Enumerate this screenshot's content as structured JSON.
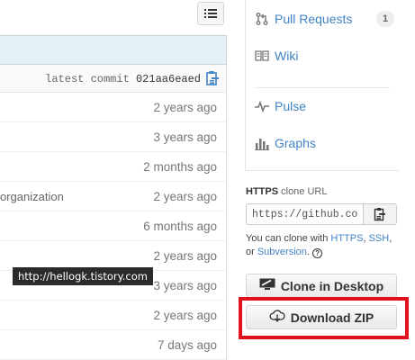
{
  "file_list": {
    "latest_commit_label": "latest commit",
    "latest_commit_sha": "021aa6eaed",
    "rows": [
      {
        "message": "",
        "age": "2 years ago"
      },
      {
        "message": "",
        "age": "3 years ago"
      },
      {
        "message": "",
        "age": "2 months ago"
      },
      {
        "message": "organization",
        "age": "2 years ago"
      },
      {
        "message": "",
        "age": "6 months ago"
      },
      {
        "message": "",
        "age": "2 years ago"
      },
      {
        "message": "",
        "age": "3 years ago"
      },
      {
        "message": "",
        "age": "2 years ago"
      },
      {
        "message": "",
        "age": "7 days ago"
      }
    ]
  },
  "watermark": "http://hellogk.tistory.com",
  "sidebar": {
    "nav": [
      {
        "label": "Pull Requests",
        "icon": "pull-request-icon",
        "count": "1"
      },
      {
        "label": "Wiki",
        "icon": "book-icon"
      },
      {
        "label": "Pulse",
        "icon": "pulse-icon"
      },
      {
        "label": "Graphs",
        "icon": "graph-icon"
      }
    ]
  },
  "clone": {
    "protocol": "HTTPS",
    "title_suffix": "clone URL",
    "url": "https://github.com/",
    "help_prefix": "You can clone with",
    "https_link": "HTTPS",
    "comma": ",",
    "ssh_link": "SSH",
    "help_or": ",\nor",
    "subversion_link": "Subversion",
    "help_end": "."
  },
  "buttons": {
    "desktop": "Clone in Desktop",
    "zip": "Download ZIP"
  },
  "colors": {
    "link": "#4183c4",
    "highlight": "#e0121c",
    "commit_bar": "#e6f1f6"
  }
}
